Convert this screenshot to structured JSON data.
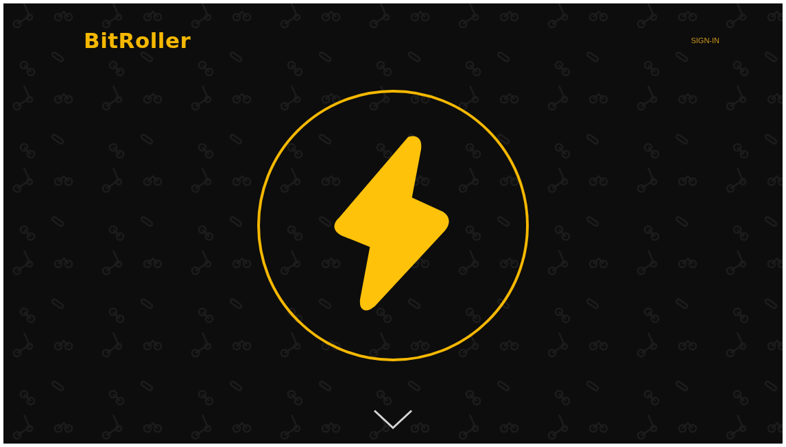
{
  "header": {
    "logo": "BitRoller",
    "sign_in": "SIGN-IN"
  }
}
